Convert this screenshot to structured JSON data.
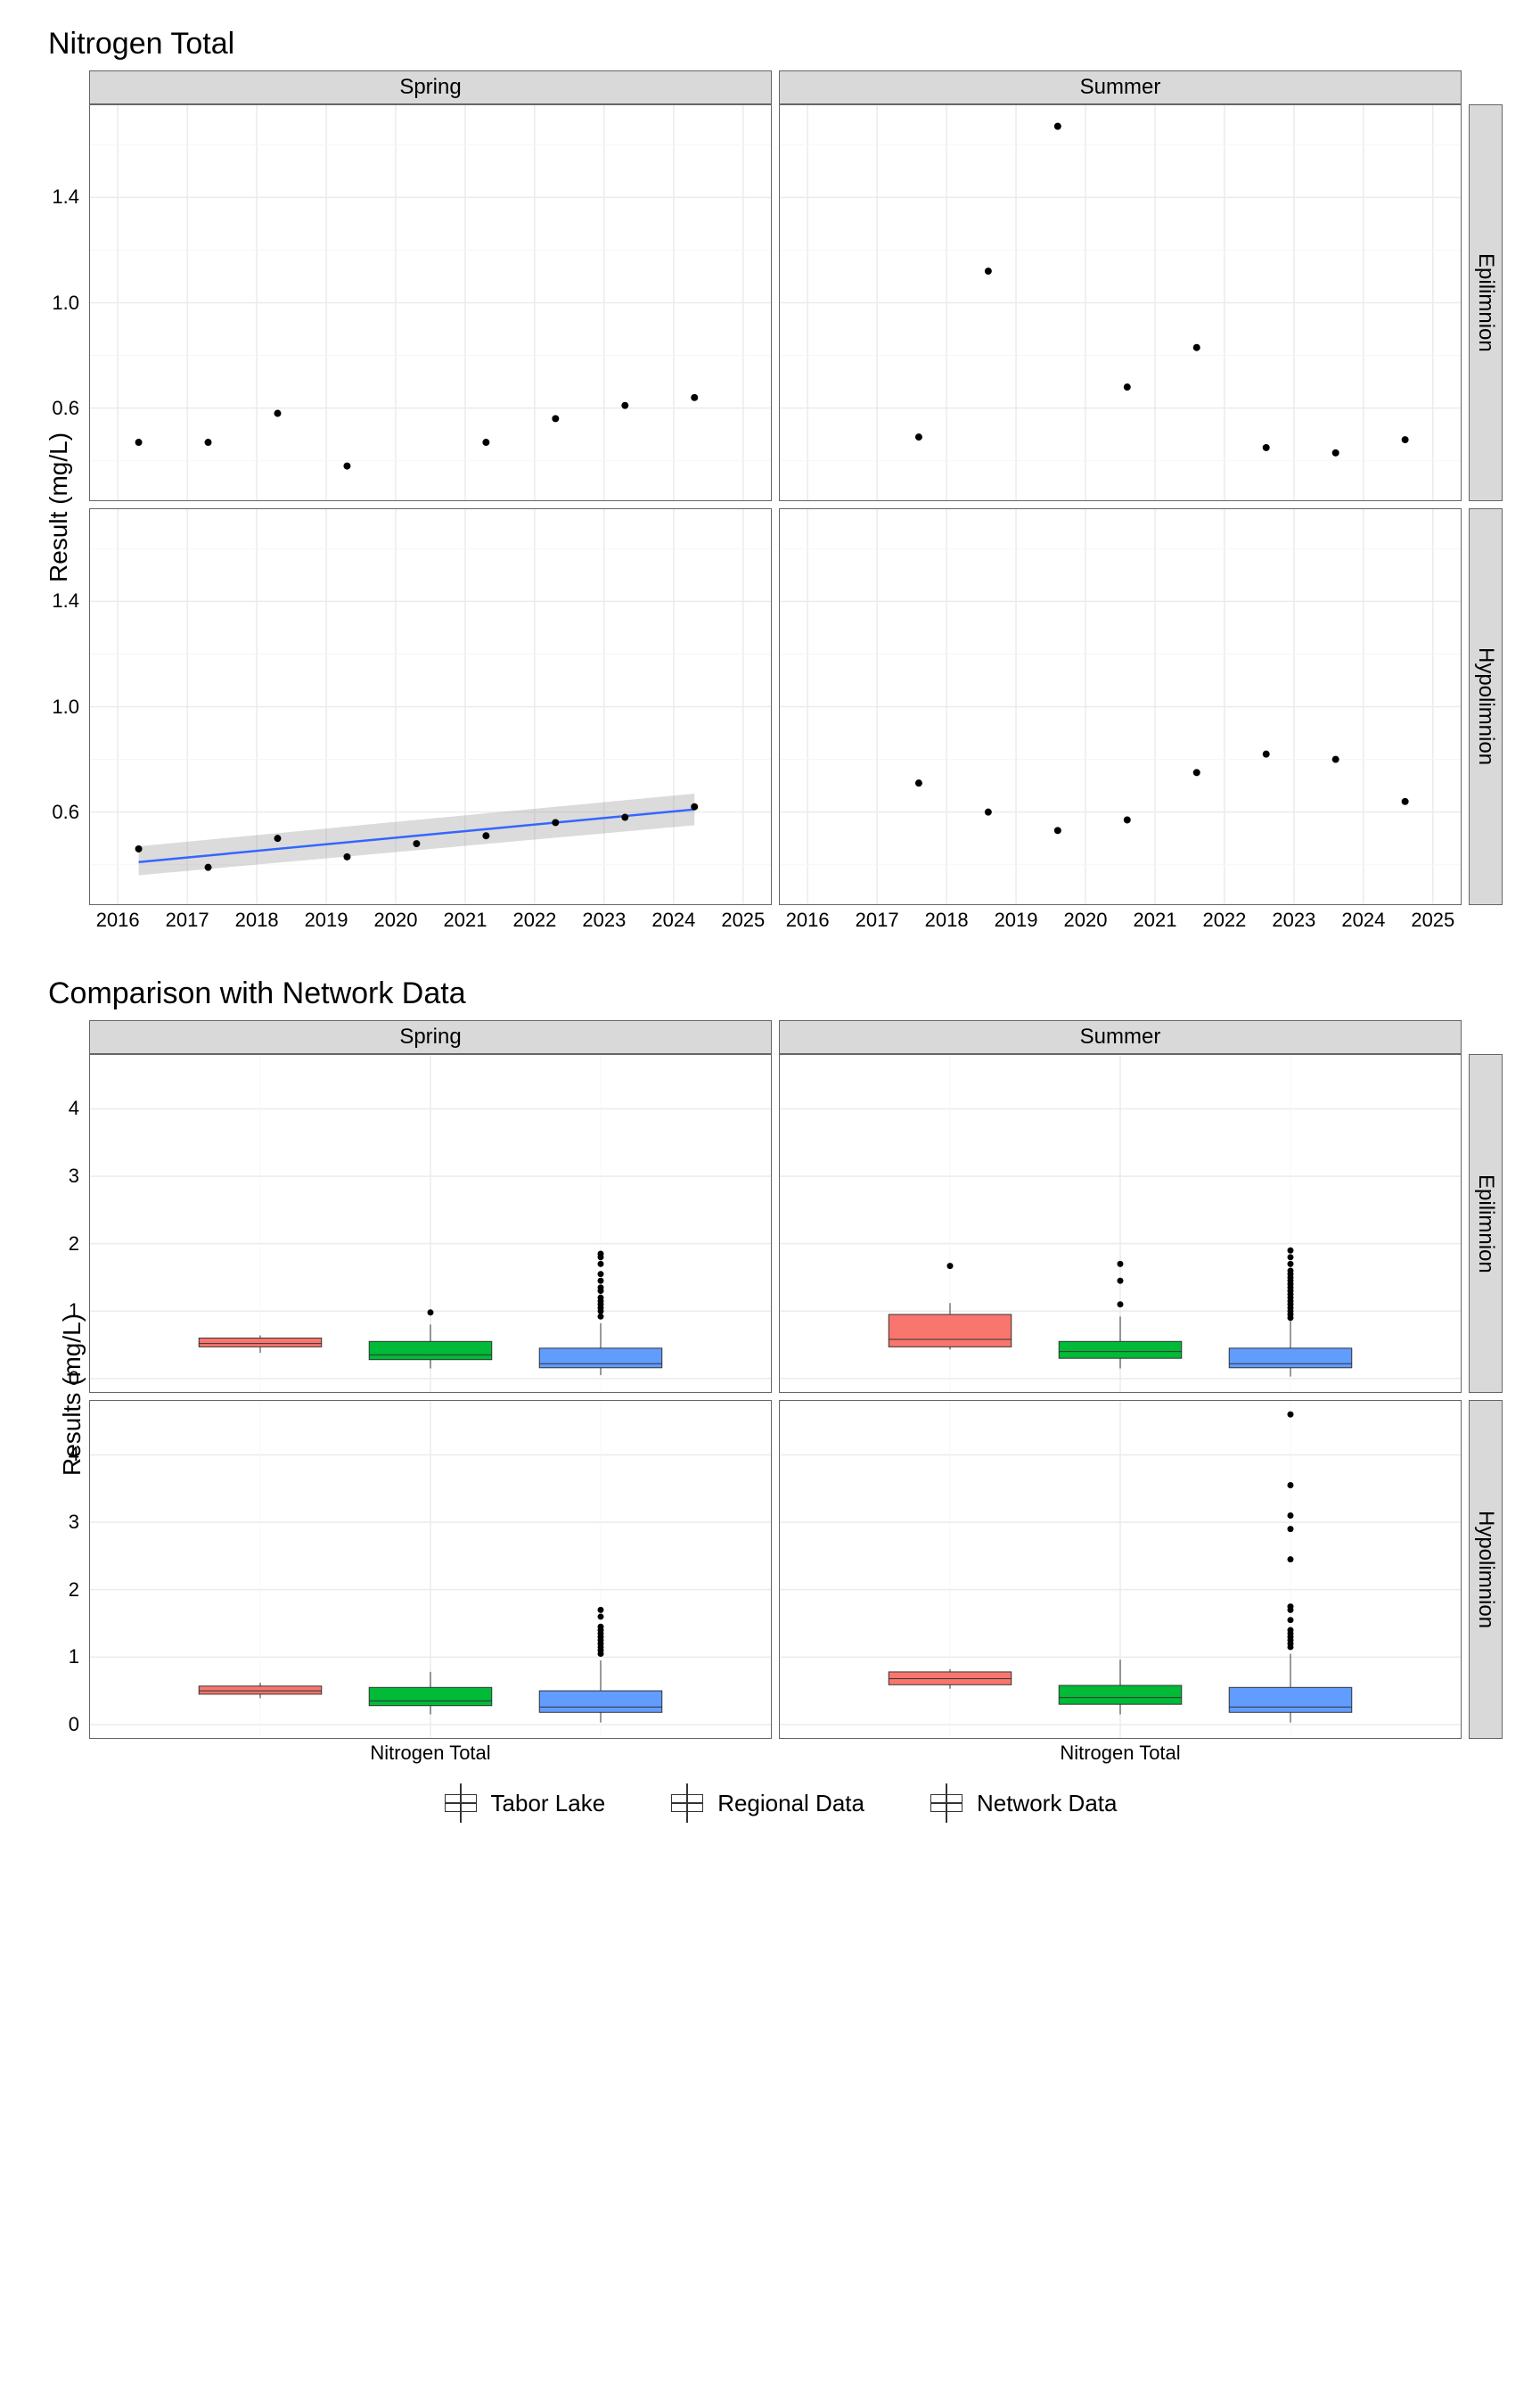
{
  "chart1": {
    "title": "Nitrogen Total",
    "ylabel": "Result (mg/L)",
    "col_facets": [
      "Spring",
      "Summer"
    ],
    "row_facets": [
      "Epilimnion",
      "Hypolimnion"
    ],
    "xlim": [
      2015.6,
      2025.4
    ],
    "ylim": [
      0.25,
      1.75
    ],
    "xticks": [
      2016,
      2017,
      2018,
      2019,
      2020,
      2021,
      2022,
      2023,
      2024,
      2025
    ],
    "yticks": [
      0.6,
      1.0,
      1.4
    ]
  },
  "chart2": {
    "title": "Comparison with Network Data",
    "ylabel": "Results (mg/L)",
    "col_facets": [
      "Spring",
      "Summer"
    ],
    "row_facets": [
      "Epilimnion",
      "Hypolimnion"
    ],
    "xcat": "Nitrogen Total",
    "ylim": [
      -0.2,
      4.8
    ],
    "yticks": [
      0,
      1,
      2,
      3,
      4
    ]
  },
  "legend": {
    "items": [
      "Tabor Lake",
      "Regional Data",
      "Network Data"
    ]
  },
  "chart_data": [
    {
      "type": "scatter",
      "title": "Nitrogen Total",
      "xlabel": "",
      "ylabel": "Result (mg/L)",
      "facets_cols": [
        "Spring",
        "Summer"
      ],
      "facets_rows": [
        "Epilimnion",
        "Hypolimnion"
      ],
      "xlim": [
        2015.6,
        2025.4
      ],
      "ylim": [
        0.25,
        1.75
      ],
      "panels": {
        "Spring_Epilimnion": {
          "x": [
            2016.3,
            2017.3,
            2018.3,
            2019.3,
            2021.3,
            2022.3,
            2023.3,
            2024.3
          ],
          "y": [
            0.47,
            0.47,
            0.58,
            0.38,
            0.47,
            0.56,
            0.61,
            0.64
          ]
        },
        "Summer_Epilimnion": {
          "x": [
            2017.6,
            2018.6,
            2019.6,
            2020.6,
            2021.6,
            2022.6,
            2023.6,
            2024.6
          ],
          "y": [
            0.49,
            1.12,
            1.67,
            0.68,
            0.83,
            0.45,
            0.43,
            0.48
          ]
        },
        "Spring_Hypolimnion": {
          "x": [
            2016.3,
            2017.3,
            2018.3,
            2019.3,
            2020.3,
            2021.3,
            2022.3,
            2023.3,
            2024.3
          ],
          "y": [
            0.46,
            0.39,
            0.5,
            0.43,
            0.48,
            0.51,
            0.56,
            0.58,
            0.62
          ],
          "trend": {
            "x": [
              2016.3,
              2024.3
            ],
            "y": [
              0.41,
              0.61
            ],
            "band": [
              [
                0.36,
                0.47
              ],
              [
                0.55,
                0.67
              ]
            ]
          }
        },
        "Summer_Hypolimnion": {
          "x": [
            2017.6,
            2018.6,
            2019.6,
            2020.6,
            2021.6,
            2022.6,
            2023.6,
            2024.6
          ],
          "y": [
            0.71,
            0.6,
            0.53,
            0.57,
            0.75,
            0.82,
            0.8,
            0.64
          ]
        }
      }
    },
    {
      "type": "boxplot",
      "title": "Comparison with Network Data",
      "xlabel": "Nitrogen Total",
      "ylabel": "Results (mg/L)",
      "facets_cols": [
        "Spring",
        "Summer"
      ],
      "facets_rows": [
        "Epilimnion",
        "Hypolimnion"
      ],
      "ylim": [
        -0.2,
        4.8
      ],
      "series_names": [
        "Tabor Lake",
        "Regional Data",
        "Network Data"
      ],
      "panels": {
        "Spring_Epilimnion": {
          "Tabor Lake": {
            "min": 0.38,
            "q1": 0.47,
            "med": 0.52,
            "q3": 0.6,
            "max": 0.64,
            "out": []
          },
          "Regional Data": {
            "min": 0.15,
            "q1": 0.28,
            "med": 0.35,
            "q3": 0.55,
            "max": 0.8,
            "out": [
              0.98
            ]
          },
          "Network Data": {
            "min": 0.05,
            "q1": 0.16,
            "med": 0.22,
            "q3": 0.45,
            "max": 0.82,
            "out": [
              0.92,
              1.0,
              1.05,
              1.1,
              1.15,
              1.2,
              1.3,
              1.35,
              1.45,
              1.55,
              1.7,
              1.8,
              1.85
            ]
          }
        },
        "Summer_Epilimnion": {
          "Tabor Lake": {
            "min": 0.43,
            "q1": 0.47,
            "med": 0.58,
            "q3": 0.95,
            "max": 1.12,
            "out": [
              1.67
            ]
          },
          "Regional Data": {
            "min": 0.15,
            "q1": 0.3,
            "med": 0.4,
            "q3": 0.55,
            "max": 0.92,
            "out": [
              1.1,
              1.45,
              1.7
            ]
          },
          "Network Data": {
            "min": 0.03,
            "q1": 0.16,
            "med": 0.22,
            "q3": 0.45,
            "max": 0.85,
            "out": [
              0.9,
              0.95,
              1.0,
              1.05,
              1.1,
              1.15,
              1.2,
              1.25,
              1.3,
              1.35,
              1.4,
              1.45,
              1.5,
              1.55,
              1.6,
              1.7,
              1.8,
              1.9
            ]
          }
        },
        "Spring_Hypolimnion": {
          "Tabor Lake": {
            "min": 0.39,
            "q1": 0.45,
            "med": 0.5,
            "q3": 0.57,
            "max": 0.62,
            "out": []
          },
          "Regional Data": {
            "min": 0.15,
            "q1": 0.28,
            "med": 0.35,
            "q3": 0.55,
            "max": 0.78,
            "out": []
          },
          "Network Data": {
            "min": 0.03,
            "q1": 0.18,
            "med": 0.26,
            "q3": 0.5,
            "max": 0.95,
            "out": [
              1.05,
              1.1,
              1.15,
              1.2,
              1.25,
              1.3,
              1.35,
              1.4,
              1.45,
              1.6,
              1.7
            ]
          }
        },
        "Summer_Hypolimnion": {
          "Tabor Lake": {
            "min": 0.53,
            "q1": 0.59,
            "med": 0.68,
            "q3": 0.78,
            "max": 0.82,
            "out": []
          },
          "Regional Data": {
            "min": 0.15,
            "q1": 0.3,
            "med": 0.4,
            "q3": 0.58,
            "max": 0.96,
            "out": []
          },
          "Network Data": {
            "min": 0.03,
            "q1": 0.18,
            "med": 0.26,
            "q3": 0.55,
            "max": 1.05,
            "out": [
              1.15,
              1.2,
              1.25,
              1.3,
              1.35,
              1.4,
              1.55,
              1.7,
              1.75,
              2.45,
              2.9,
              3.1,
              3.55,
              4.6
            ]
          }
        }
      }
    }
  ]
}
